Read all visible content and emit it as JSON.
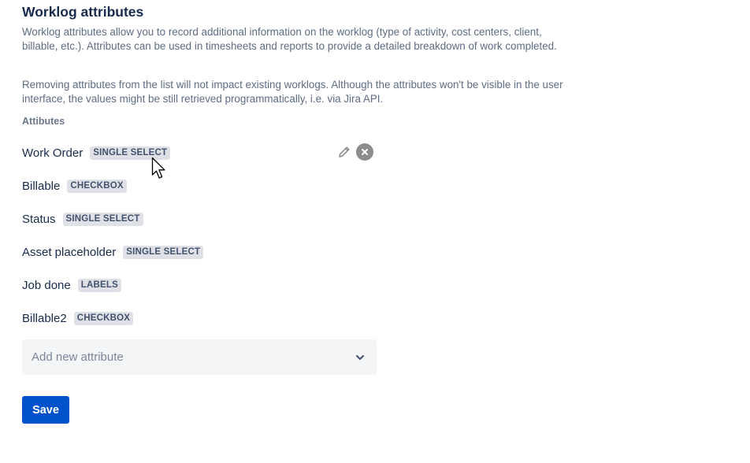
{
  "header": {
    "title": "Worklog attributes"
  },
  "description": {
    "paragraph_1": "Worklog attributes allow you to record additional information on the worklog (type of activity, cost centers, client, billable, etc.). Attributes can be used in timesheets and reports to provide a detailed breakdown of work completed.",
    "paragraph_2": "Removing attributes from the list will not impact existing worklogs. Although the attributes won't be visible in the user interface, the values might be still retrieved programmatically, i.e. via Jira API."
  },
  "attributes": {
    "label": "Attibutes",
    "items": [
      {
        "name": "Work Order",
        "type": "SINGLE SELECT"
      },
      {
        "name": "Billable",
        "type": "CHECKBOX"
      },
      {
        "name": "Status",
        "type": "SINGLE SELECT"
      },
      {
        "name": "Asset placeholder",
        "type": "SINGLE SELECT"
      },
      {
        "name": "Job done",
        "type": "LABELS"
      },
      {
        "name": "Billable2",
        "type": "CHECKBOX"
      }
    ],
    "hovered_row_actions": {
      "edit_icon": "pencil-icon",
      "remove_icon": "close-circle-icon"
    }
  },
  "add_attribute": {
    "placeholder": "Add new attribute",
    "icon": "chevron-down-icon"
  },
  "actions": {
    "save_label": "Save"
  },
  "colors": {
    "primary": "#0052cc",
    "heading": "#172b4d",
    "muted_text": "#5e6c84",
    "lozenge_bg": "#dfe1e6",
    "lozenge_text": "#42526e",
    "select_bg": "#f4f5f7"
  }
}
